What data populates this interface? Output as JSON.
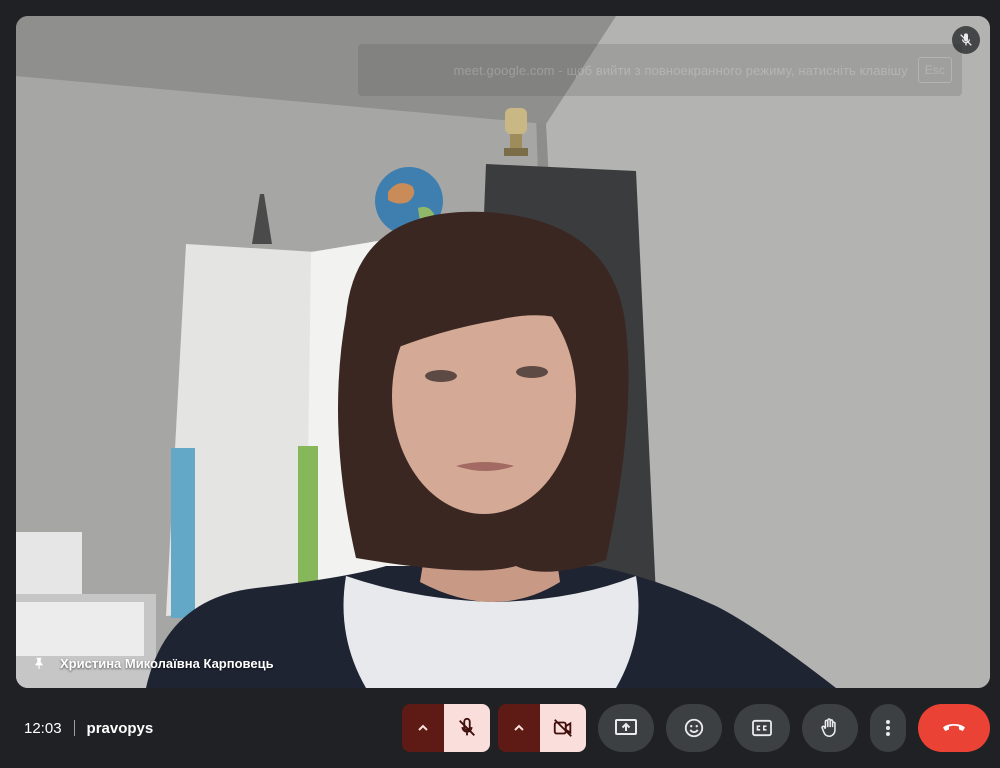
{
  "fullscreen_notice": {
    "message": "meet.google.com - щоб вийти з повноекранного режиму, натисніть клавішу",
    "key": "Esc"
  },
  "participant": {
    "name": "Христина Миколаївна Карповець",
    "muted": true
  },
  "meeting": {
    "time": "12:03",
    "code": "pravopys"
  },
  "controls": {
    "mic_icon": "mic-off-icon",
    "camera_icon": "camera-off-icon",
    "present_icon": "present-screen-icon",
    "reactions_icon": "emoji-icon",
    "captions_icon": "closed-captions-icon",
    "hand_icon": "raise-hand-icon",
    "more_icon": "more-vert-icon",
    "leave_icon": "call-end-icon"
  },
  "colors": {
    "toolbar_bg": "#202124",
    "muted_button_bg": "#f9dedc",
    "muted_caret_bg": "#5e1a14",
    "round_button_bg": "#3c4043",
    "leave_button_bg": "#ea4335"
  }
}
